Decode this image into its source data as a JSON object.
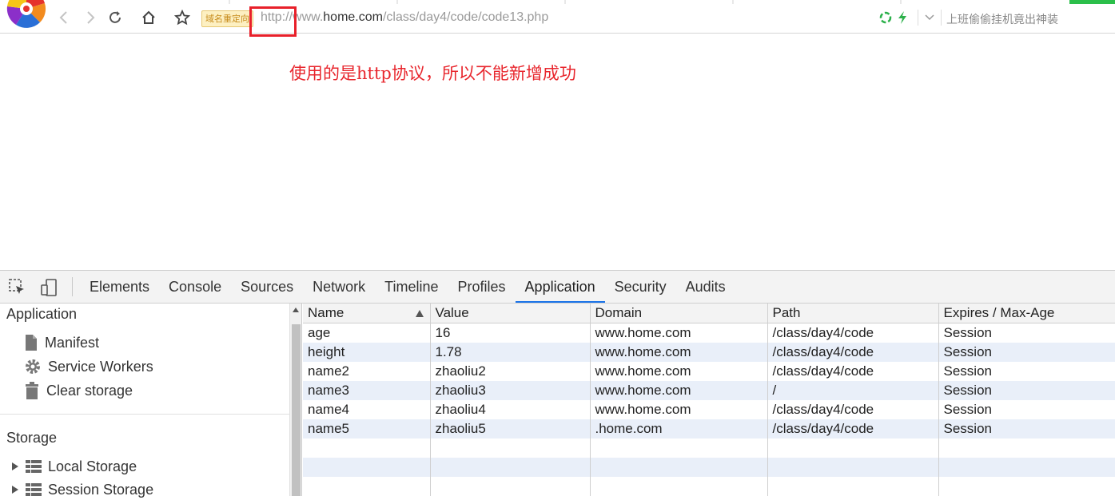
{
  "browser": {
    "redirect_badge": "域名重定向",
    "url_scheme": "http://",
    "url_sub": "www.",
    "url_host": "home.com",
    "url_path": "/class/day4/code/code13.php",
    "search_hint": "上班偷偷挂机竟出神装",
    "icons": [
      "back-icon",
      "forward-icon",
      "reload-icon",
      "home-icon",
      "star-icon",
      "recycle-icon",
      "lightning-icon",
      "dropdown-icon"
    ]
  },
  "page": {
    "message": "使用的是http协议，所以不能新增成功"
  },
  "devtools": {
    "tabs": [
      "Elements",
      "Console",
      "Sources",
      "Network",
      "Timeline",
      "Profiles",
      "Application",
      "Security",
      "Audits"
    ],
    "active_tab": "Application",
    "sidebar": {
      "application_header": "Application",
      "application_items": [
        "Manifest",
        "Service Workers",
        "Clear storage"
      ],
      "storage_header": "Storage",
      "storage_items": [
        "Local Storage",
        "Session Storage"
      ]
    },
    "cookies": {
      "columns": [
        "Name",
        "Value",
        "Domain",
        "Path",
        "Expires / Max-Age"
      ],
      "sort_column": "Name",
      "rows": [
        [
          "age",
          "16",
          "www.home.com",
          "/class/day4/code",
          "Session"
        ],
        [
          "height",
          "1.78",
          "www.home.com",
          "/class/day4/code",
          "Session"
        ],
        [
          "name2",
          "zhaoliu2",
          "www.home.com",
          "/class/day4/code",
          "Session"
        ],
        [
          "name3",
          "zhaoliu3",
          "www.home.com",
          "/",
          "Session"
        ],
        [
          "name4",
          "zhaoliu4",
          "www.home.com",
          "/class/day4/code",
          "Session"
        ],
        [
          "name5",
          "zhaoliu5",
          ".home.com",
          "/class/day4/code",
          "Session"
        ]
      ]
    }
  },
  "colors": {
    "accent_red": "#e8202a",
    "message_red": "#e8262d",
    "active_tab_underline": "#1a73e8",
    "row_alt": "#e9eff9"
  }
}
